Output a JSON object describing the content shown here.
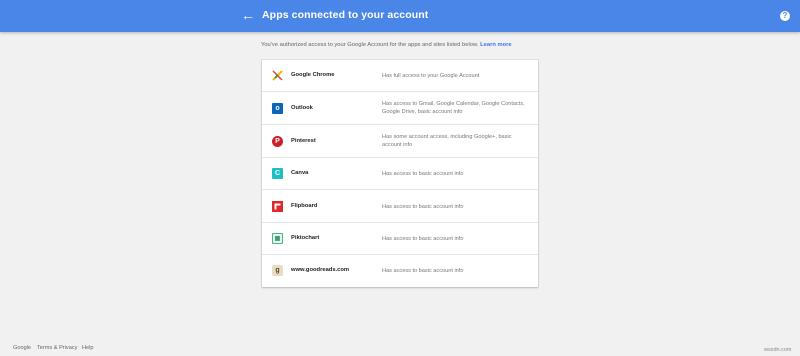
{
  "header": {
    "title": "Apps connected to your account",
    "back_icon": "arrow-left-icon",
    "help_icon": "help-circle-icon",
    "background": "#4a86e8"
  },
  "intro": {
    "text": "You've authorized access to your Google Account for the apps and sites listed below.",
    "link": "Learn more"
  },
  "apps": [
    {
      "name": "Google Chrome",
      "access": "Has full access to your Google Account",
      "icon": "chrome-icon"
    },
    {
      "name": "Outlook",
      "access": "Has access to Gmail, Google Calendar, Google Contacts, Google Drive, basic account info",
      "icon": "outlook-icon"
    },
    {
      "name": "Pinterest",
      "access": "Has some account access, including Google+, basic account info",
      "icon": "pinterest-icon"
    },
    {
      "name": "Canva",
      "access": "Has access to basic account info",
      "icon": "canva-icon"
    },
    {
      "name": "Flipboard",
      "access": "Has access to basic account info",
      "icon": "flipboard-icon"
    },
    {
      "name": "Piktochart",
      "access": "Has access to basic account info",
      "icon": "piktochart-icon"
    },
    {
      "name": "www.goodreads.com",
      "access": "Has access to basic account info",
      "icon": "goodreads-icon"
    }
  ],
  "footer": {
    "google": "Google",
    "terms": "Terms & Privacy",
    "help": "Help"
  },
  "watermark": "wsxdn.com"
}
